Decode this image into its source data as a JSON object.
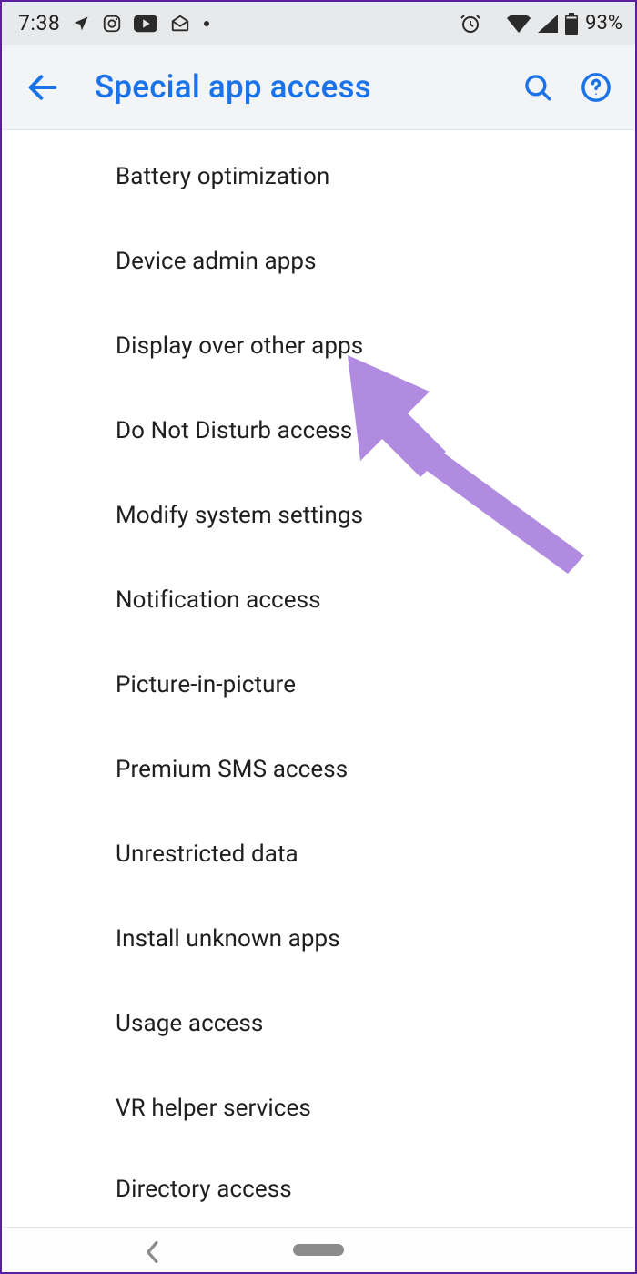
{
  "status": {
    "time": "7:38",
    "battery_pct": "93%"
  },
  "header": {
    "title": "Special app access"
  },
  "items": [
    "Battery optimization",
    "Device admin apps",
    "Display over other apps",
    "Do Not Disturb access",
    "Modify system settings",
    "Notification access",
    "Picture-in-picture",
    "Premium SMS access",
    "Unrestricted data",
    "Install unknown apps",
    "Usage access",
    "VR helper services",
    "Directory access"
  ],
  "annotation": {
    "arrow_color": "#b18be0"
  }
}
